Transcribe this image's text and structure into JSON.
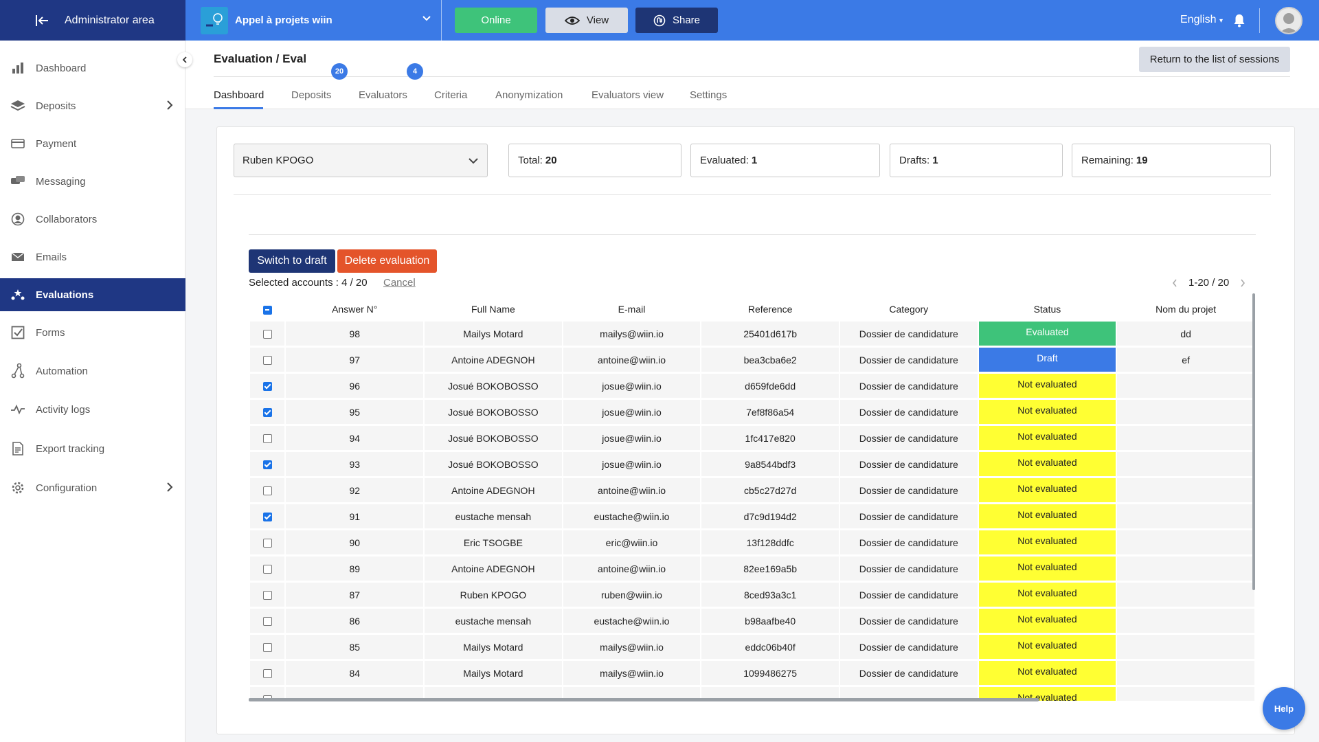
{
  "topbar": {
    "admin_label": "Administrator area",
    "project_name": "Appel à projets wiin",
    "online_label": "Online",
    "view_label": "View",
    "share_label": "Share",
    "language": "English",
    "colors": {
      "bar": "#3b7ae6",
      "admin": "#1f3784",
      "online": "#3ec37a",
      "share": "#1e3575"
    }
  },
  "sidebar": {
    "items": [
      {
        "label": "Dashboard",
        "icon": "bar-chart-icon"
      },
      {
        "label": "Deposits",
        "icon": "layers-icon"
      },
      {
        "label": "Payment",
        "icon": "credit-card-icon"
      },
      {
        "label": "Messaging",
        "icon": "chat-icon"
      },
      {
        "label": "Collaborators",
        "icon": "user-circle-icon"
      },
      {
        "label": "Emails",
        "icon": "envelope-icon"
      },
      {
        "label": "Evaluations",
        "icon": "stars-icon"
      },
      {
        "label": "Forms",
        "icon": "checkbox-icon"
      },
      {
        "label": "Automation",
        "icon": "flow-icon"
      },
      {
        "label": "Activity logs",
        "icon": "pulse-icon"
      },
      {
        "label": "Export tracking",
        "icon": "document-icon"
      },
      {
        "label": "Configuration",
        "icon": "gear-icon"
      }
    ]
  },
  "header": {
    "breadcrumb": "Evaluation / Eval",
    "return_label": "Return to the list of sessions",
    "tabs": [
      {
        "label": "Dashboard"
      },
      {
        "label": "Deposits",
        "badge": "20"
      },
      {
        "label": "Evaluators",
        "badge": "4"
      },
      {
        "label": "Criteria"
      },
      {
        "label": "Anonymization"
      },
      {
        "label": "Evaluators view"
      },
      {
        "label": "Settings"
      }
    ]
  },
  "filters": {
    "evaluator": "Ruben KPOGO",
    "total_label": "Total:",
    "total_value": "20",
    "evaluated_label": "Evaluated:",
    "evaluated_value": "1",
    "drafts_label": "Drafts:",
    "drafts_value": "1",
    "remaining_label": "Remaining:",
    "remaining_value": "19"
  },
  "actions": {
    "switch_draft": "Switch to draft",
    "delete_eval": "Delete evaluation",
    "selected": "Selected accounts : 4 / 20",
    "cancel": "Cancel",
    "pagination": "1-20 / 20"
  },
  "table": {
    "columns": [
      "Answer N°",
      "Full Name",
      "E-mail",
      "Reference",
      "Category",
      "Status",
      "Nom du projet"
    ],
    "rows": [
      {
        "checked": false,
        "answer": "98",
        "name": "Mailys Motard",
        "email": "mailys@wiin.io",
        "ref": "25401d617b",
        "category": "Dossier de candidature",
        "status": "Evaluated",
        "status_type": "evaluated",
        "project": "dd"
      },
      {
        "checked": false,
        "answer": "97",
        "name": "Antoine ADEGNOH",
        "email": "antoine@wiin.io",
        "ref": "bea3cba6e2",
        "category": "Dossier de candidature",
        "status": "Draft",
        "status_type": "draft",
        "project": "ef"
      },
      {
        "checked": true,
        "answer": "96",
        "name": "Josué BOKOBOSSO",
        "email": "josue@wiin.io",
        "ref": "d659fde6dd",
        "category": "Dossier de candidature",
        "status": "Not evaluated",
        "status_type": "none",
        "project": ""
      },
      {
        "checked": true,
        "answer": "95",
        "name": "Josué BOKOBOSSO",
        "email": "josue@wiin.io",
        "ref": "7ef8f86a54",
        "category": "Dossier de candidature",
        "status": "Not evaluated",
        "status_type": "none",
        "project": ""
      },
      {
        "checked": false,
        "answer": "94",
        "name": "Josué BOKOBOSSO",
        "email": "josue@wiin.io",
        "ref": "1fc417e820",
        "category": "Dossier de candidature",
        "status": "Not evaluated",
        "status_type": "none",
        "project": ""
      },
      {
        "checked": true,
        "answer": "93",
        "name": "Josué BOKOBOSSO",
        "email": "josue@wiin.io",
        "ref": "9a8544bdf3",
        "category": "Dossier de candidature",
        "status": "Not evaluated",
        "status_type": "none",
        "project": ""
      },
      {
        "checked": false,
        "answer": "92",
        "name": "Antoine ADEGNOH",
        "email": "antoine@wiin.io",
        "ref": "cb5c27d27d",
        "category": "Dossier de candidature",
        "status": "Not evaluated",
        "status_type": "none",
        "project": ""
      },
      {
        "checked": true,
        "answer": "91",
        "name": "eustache mensah",
        "email": "eustache@wiin.io",
        "ref": "d7c9d194d2",
        "category": "Dossier de candidature",
        "status": "Not evaluated",
        "status_type": "none",
        "project": ""
      },
      {
        "checked": false,
        "answer": "90",
        "name": "Eric TSOGBE",
        "email": "eric@wiin.io",
        "ref": "13f128ddfc",
        "category": "Dossier de candidature",
        "status": "Not evaluated",
        "status_type": "none",
        "project": ""
      },
      {
        "checked": false,
        "answer": "89",
        "name": "Antoine ADEGNOH",
        "email": "antoine@wiin.io",
        "ref": "82ee169a5b",
        "category": "Dossier de candidature",
        "status": "Not evaluated",
        "status_type": "none",
        "project": ""
      },
      {
        "checked": false,
        "answer": "87",
        "name": "Ruben KPOGO",
        "email": "ruben@wiin.io",
        "ref": "8ced93a3c1",
        "category": "Dossier de candidature",
        "status": "Not evaluated",
        "status_type": "none",
        "project": ""
      },
      {
        "checked": false,
        "answer": "86",
        "name": "eustache mensah",
        "email": "eustache@wiin.io",
        "ref": "b98aafbe40",
        "category": "Dossier de candidature",
        "status": "Not evaluated",
        "status_type": "none",
        "project": ""
      },
      {
        "checked": false,
        "answer": "85",
        "name": "Mailys Motard",
        "email": "mailys@wiin.io",
        "ref": "eddc06b40f",
        "category": "Dossier de candidature",
        "status": "Not evaluated",
        "status_type": "none",
        "project": ""
      },
      {
        "checked": false,
        "answer": "84",
        "name": "Mailys Motard",
        "email": "mailys@wiin.io",
        "ref": "1099486275",
        "category": "Dossier de candidature",
        "status": "Not evaluated",
        "status_type": "none",
        "project": ""
      },
      {
        "checked": false,
        "answer": "",
        "name": "",
        "email": "",
        "ref": "",
        "category": "",
        "status": "Not evaluated",
        "status_type": "none",
        "project": ""
      }
    ]
  },
  "help_label": "Help"
}
